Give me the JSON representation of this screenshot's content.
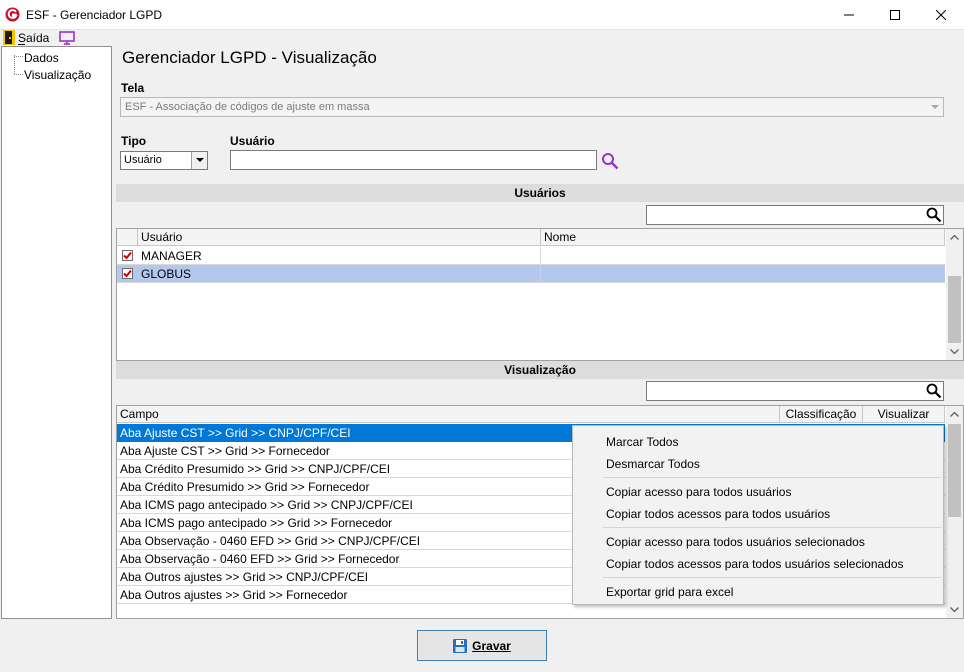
{
  "window": {
    "title": "ESF - Gerenciador LGPD"
  },
  "menu": {
    "exit_label": "Saída"
  },
  "tree": {
    "items": [
      "Dados",
      "Visualização"
    ]
  },
  "page": {
    "title": "Gerenciador LGPD - Visualização"
  },
  "tela": {
    "label": "Tela",
    "value": "ESF - Associação de códigos de ajuste em massa"
  },
  "tipo": {
    "label": "Tipo",
    "value": "Usuário"
  },
  "usuario": {
    "label": "Usuário",
    "value": ""
  },
  "users_section": {
    "title": "Usuários",
    "columns": [
      "Usuário",
      "Nome"
    ],
    "rows": [
      {
        "usuario": "MANAGER",
        "nome": "",
        "checked": true,
        "selected": false
      },
      {
        "usuario": "GLOBUS",
        "nome": "",
        "checked": true,
        "selected": true
      }
    ]
  },
  "vis_section": {
    "title": "Visualização",
    "columns": [
      "Campo",
      "Classificação",
      "Visualizar"
    ],
    "rows": [
      "Aba Ajuste CST >> Grid >> CNPJ/CPF/CEI",
      "Aba Ajuste CST >> Grid >> Fornecedor",
      "Aba Crédito Presumido >> Grid >> CNPJ/CPF/CEI",
      "Aba Crédito Presumido >> Grid >> Fornecedor",
      "Aba ICMS pago antecipado >> Grid >> CNPJ/CPF/CEI",
      "Aba ICMS pago antecipado >> Grid >> Fornecedor",
      "Aba Observação - 0460 EFD >> Grid >> CNPJ/CPF/CEI",
      "Aba Observação - 0460 EFD >> Grid >> Fornecedor",
      "Aba Outros ajustes >> Grid >> CNPJ/CPF/CEI",
      "Aba Outros ajustes >> Grid >> Fornecedor"
    ]
  },
  "context_menu": {
    "items": [
      "Marcar Todos",
      "Desmarcar Todos",
      "Copiar acesso para todos usuários",
      "Copiar todos acessos para todos usuários",
      "Copiar acesso para todos usuários selecionados",
      "Copiar todos acessos para todos usuários selecionados",
      "Exportar grid para excel"
    ]
  },
  "actions": {
    "save_label": "Gravar"
  },
  "colors": {
    "selection": "#0078d7",
    "row_selected": "#b4c8ee",
    "accent_red": "#cc0000",
    "purple_icon": "#9b30c8"
  }
}
